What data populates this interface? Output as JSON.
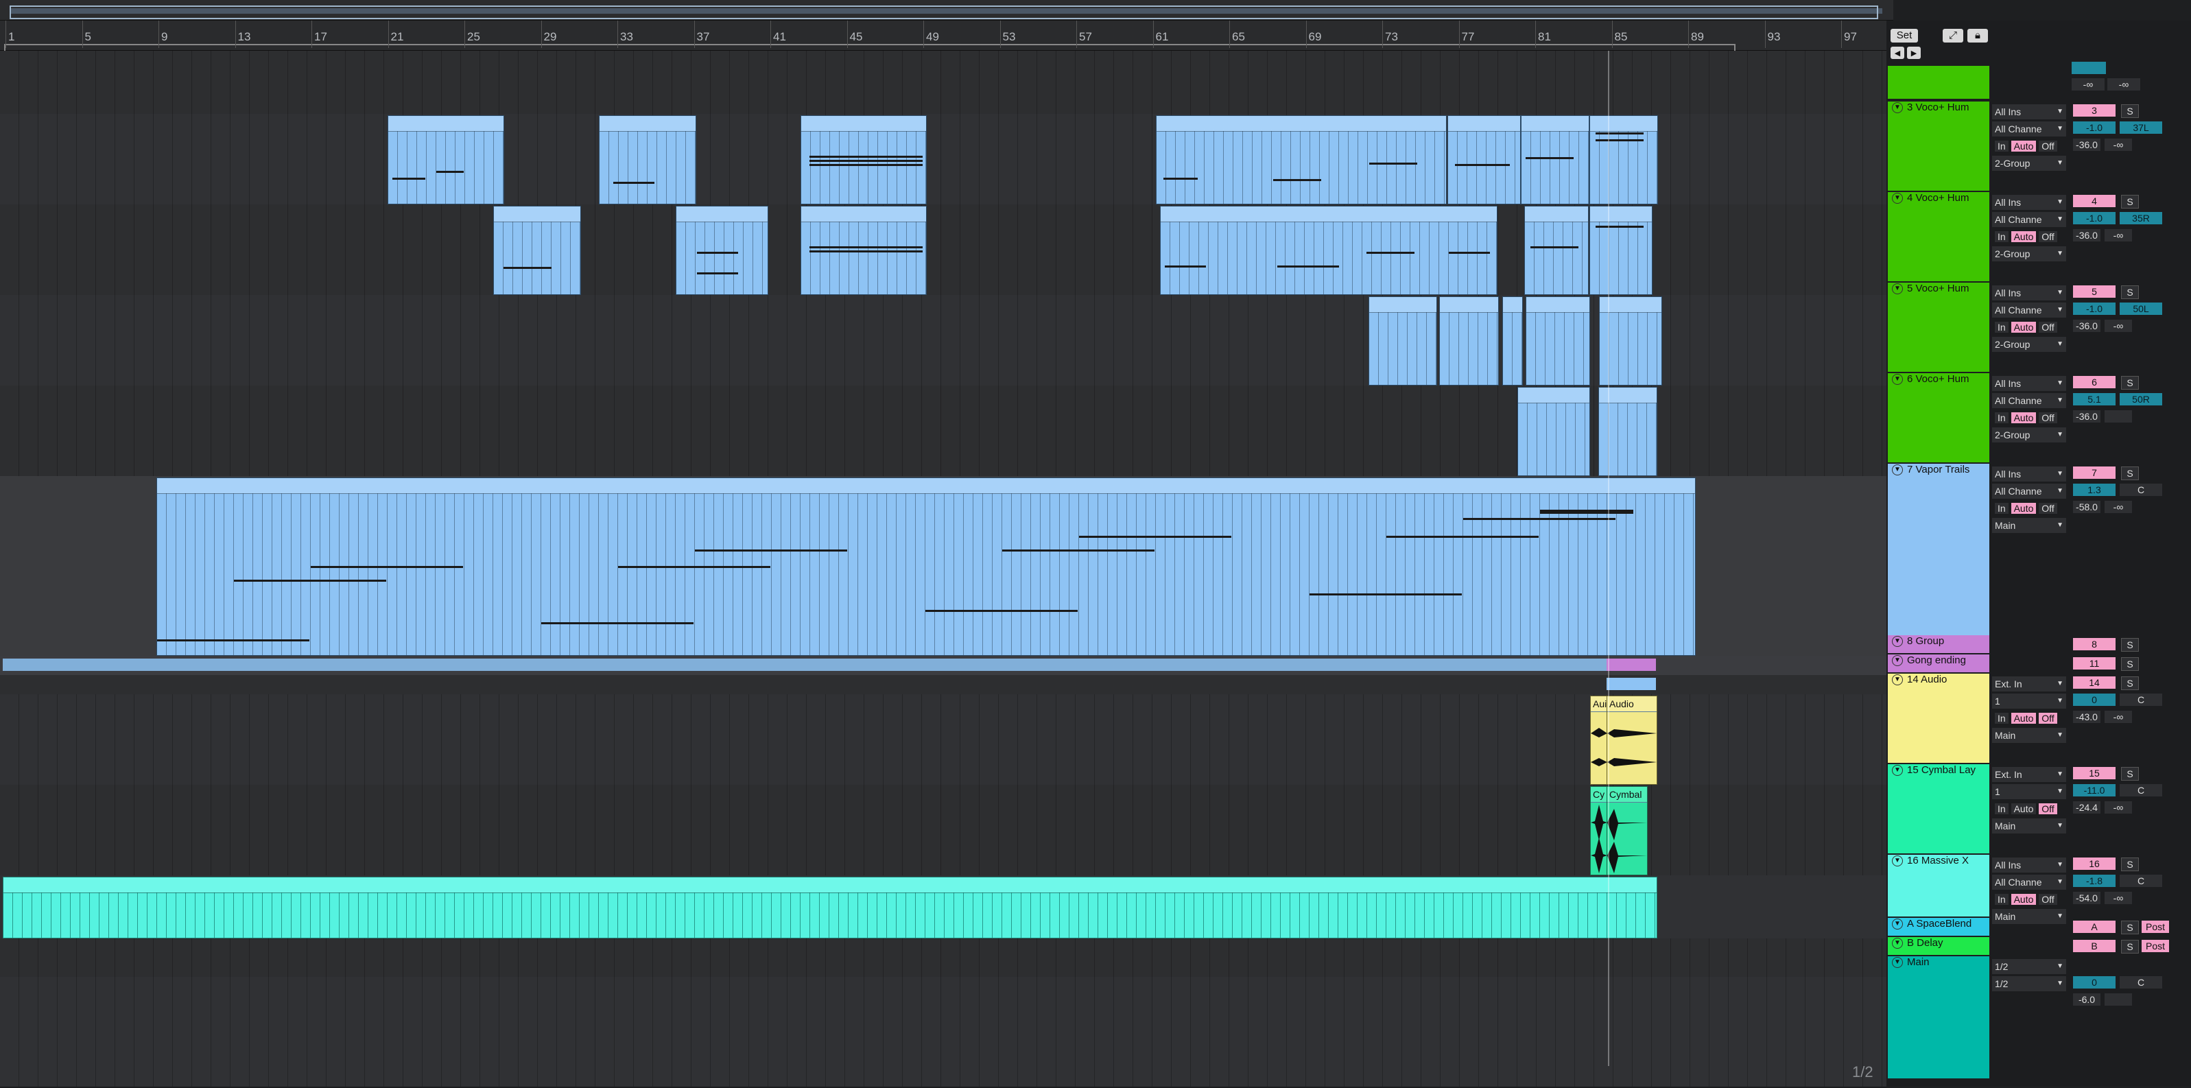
{
  "ruler": {
    "bars": [
      "1",
      "5",
      "9",
      "13",
      "17",
      "21",
      "25",
      "29",
      "33",
      "37",
      "41",
      "45",
      "49",
      "53",
      "57",
      "61",
      "65",
      "69",
      "73",
      "77",
      "81",
      "85",
      "89",
      "93",
      "97"
    ]
  },
  "mixer_header": {
    "set_label": "Set",
    "expand_icon": "expand-icon",
    "lock_icon": "lock-icon"
  },
  "mixer_top": {
    "val1": "-∞",
    "val2": "-∞"
  },
  "tracks": [
    {
      "name": "3 Voco+ Hum",
      "color": "#3ec400",
      "input": "All Ins",
      "channel": "All Channe",
      "monitor": [
        "In",
        "Auto",
        "Off"
      ],
      "output": "2-Group",
      "number": "3",
      "volume": "-1.0",
      "pan": "37L",
      "send": "-36.0",
      "send2": "-∞"
    },
    {
      "name": "4 Voco+ Hum",
      "color": "#3ec400",
      "input": "All Ins",
      "channel": "All Channe",
      "monitor": [
        "In",
        "Auto",
        "Off"
      ],
      "output": "2-Group",
      "number": "4",
      "volume": "-1.0",
      "pan": "35R",
      "send": "-36.0",
      "send2": "-∞"
    },
    {
      "name": "5 Voco+ Hum",
      "color": "#3ec400",
      "input": "All Ins",
      "channel": "All Channe",
      "monitor": [
        "In",
        "Auto",
        "Off"
      ],
      "output": "2-Group",
      "number": "5",
      "volume": "-1.0",
      "pan": "50L",
      "send": "-36.0",
      "send2": "-∞"
    },
    {
      "name": "6 Voco+ Hum",
      "color": "#3ec400",
      "input": "All Ins",
      "channel": "All Channe",
      "monitor": [
        "In",
        "Auto",
        "Off"
      ],
      "output": "2-Group",
      "number": "6",
      "volume": "5.1",
      "pan": "50R",
      "send": "-36.0",
      "send2": ""
    },
    {
      "name": "7 Vapor Trails",
      "color": "#8ec3f4",
      "input": "All Ins",
      "channel": "All Channe",
      "monitor": [
        "In",
        "Auto",
        "Off"
      ],
      "output": "Main",
      "number": "7",
      "volume": "1.3",
      "pan": "C",
      "send": "-58.0",
      "send2": "-∞"
    },
    {
      "name": "8 Group",
      "color": "#c77fd6",
      "number": "8"
    },
    {
      "name": "Gong ending",
      "color": "#c77fd6",
      "number": "11"
    },
    {
      "name": "14 Audio",
      "color": "#f6f08c",
      "input": "Ext. In",
      "channel": "1",
      "monitor": [
        "In",
        "Auto",
        "Off"
      ],
      "output": "Main",
      "number": "14",
      "volume": "0",
      "pan": "C",
      "send": "-43.0",
      "send2": "-∞"
    },
    {
      "name": "15 Cymbal Lay",
      "color": "#22f0a8",
      "input": "Ext. In",
      "channel": "1",
      "monitor": [
        "In",
        "Auto",
        "Off"
      ],
      "output": "Main",
      "number": "15",
      "volume": "-11.0",
      "pan": "C",
      "send": "-24.4",
      "send2": "-∞"
    },
    {
      "name": "16 Massive X",
      "color": "#5ff6e6",
      "input": "All Ins",
      "channel": "All Channe",
      "monitor": [
        "In",
        "Auto",
        "Off"
      ],
      "output": "Main",
      "number": "16",
      "volume": "-1.8",
      "pan": "C",
      "send": "-54.0",
      "send2": "-∞"
    },
    {
      "name": "A SpaceBlend",
      "color": "#2ecbe8",
      "number": "A",
      "post": "Post"
    },
    {
      "name": "B Delay",
      "color": "#1fe84a",
      "number": "B",
      "post": "Post"
    },
    {
      "name": "Main",
      "color": "#00b8a8",
      "input": "1/2",
      "channel": "1/2",
      "volume": "0",
      "pan": "C",
      "send": "-6.0"
    }
  ],
  "clips": {
    "audio_label": "Audio",
    "audio_label_short": "Aui",
    "cymbal_label": "Cymbal",
    "cymbal_label_short": "Cy"
  },
  "page_indicator": "1/2",
  "s_label": "S"
}
